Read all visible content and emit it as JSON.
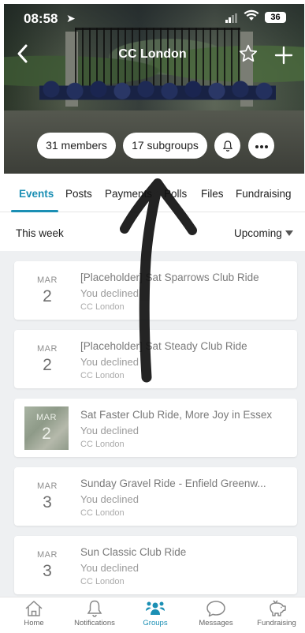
{
  "status_bar": {
    "time": "08:58",
    "battery": "36"
  },
  "header": {
    "title": "CC London"
  },
  "chips": {
    "members": "31 members",
    "subgroups": "17 subgroups"
  },
  "tabs": [
    {
      "label": "Events",
      "active": true
    },
    {
      "label": "Posts"
    },
    {
      "label": "Payments"
    },
    {
      "label": "Polls"
    },
    {
      "label": "Files"
    },
    {
      "label": "Fundraising"
    }
  ],
  "filters": {
    "left": "This week",
    "right": "Upcoming"
  },
  "events": [
    {
      "month": "MAR",
      "day": "2",
      "title": "[Placeholder] Sat Sparrows Club Ride",
      "rsvp": "You declined",
      "org": "CC London",
      "has_image": false
    },
    {
      "month": "MAR",
      "day": "2",
      "title": "[Placeholder] Sat Steady Club Ride",
      "rsvp": "You declined",
      "org": "CC London",
      "has_image": false
    },
    {
      "month": "MAR",
      "day": "2",
      "title": "Sat Faster Club Ride, More Joy in Essex",
      "rsvp": "You declined",
      "org": "CC London",
      "has_image": true
    },
    {
      "month": "MAR",
      "day": "3",
      "title": "Sunday Gravel Ride - Enfield Greenw...",
      "rsvp": "You declined",
      "org": "CC London",
      "has_image": false
    },
    {
      "month": "MAR",
      "day": "3",
      "title": "Sun Classic Club Ride",
      "rsvp": "You declined",
      "org": "CC London",
      "has_image": false
    }
  ],
  "bottom_nav": [
    {
      "label": "Home",
      "icon": "home-icon"
    },
    {
      "label": "Notifications",
      "icon": "bell-icon"
    },
    {
      "label": "Groups",
      "icon": "groups-icon",
      "active": true
    },
    {
      "label": "Messages",
      "icon": "chat-icon"
    },
    {
      "label": "Fundraising",
      "icon": "piggy-bank-icon"
    }
  ],
  "colors": {
    "accent": "#1b8fb4",
    "list_background": "#eef0f2"
  }
}
